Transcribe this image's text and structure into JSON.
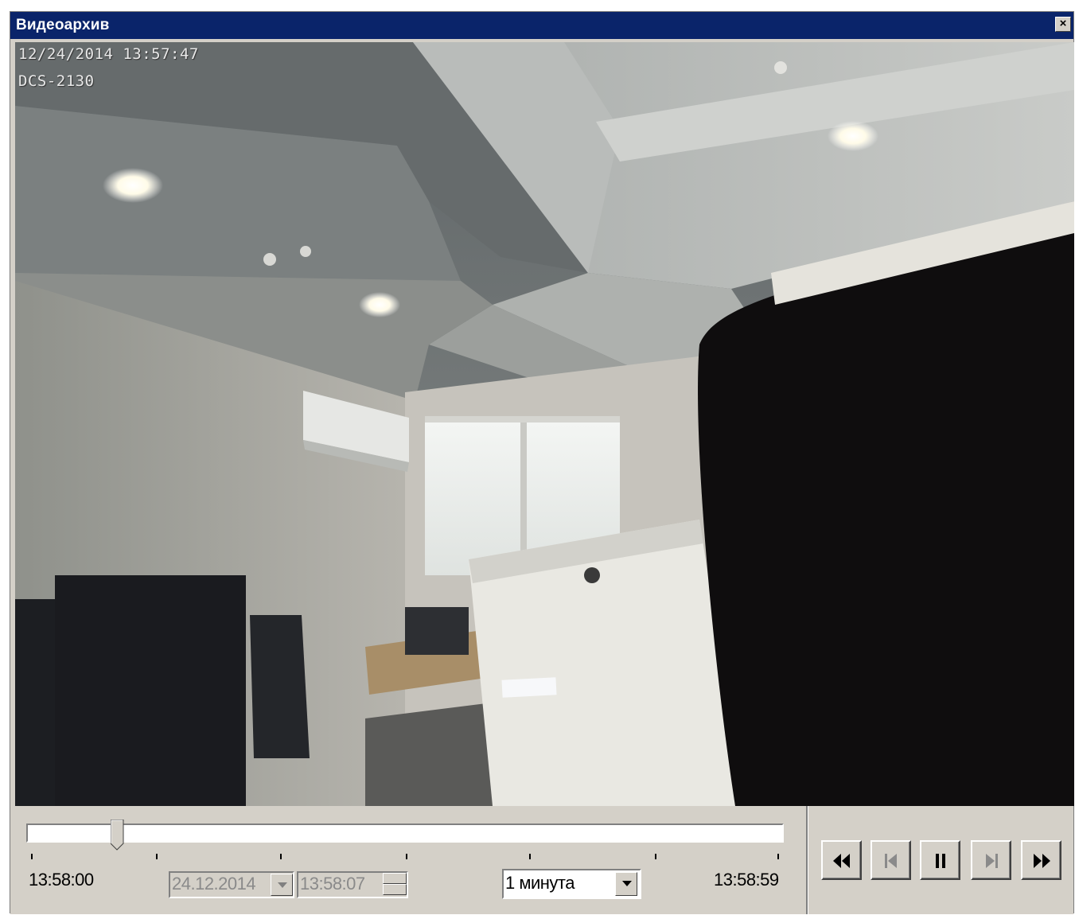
{
  "window": {
    "title": "Видеоархив",
    "close_label": "×"
  },
  "video": {
    "osd_datetime": "12/24/2014  13:57:47",
    "osd_camera": "DCS-2130"
  },
  "timeline": {
    "start_time": "13:58:00",
    "end_time": "13:58:59",
    "position_fraction": 0.12,
    "date_value": "24.12.2014",
    "time_value": "13:58:07",
    "scale_value": "1 минута"
  },
  "playback": {
    "buttons": [
      "rewind-icon",
      "skip-start-icon",
      "pause-icon",
      "skip-end-icon",
      "fast-forward-icon"
    ]
  },
  "colors": {
    "titlebar": "#0a246a",
    "panel": "#d4d0c8"
  }
}
